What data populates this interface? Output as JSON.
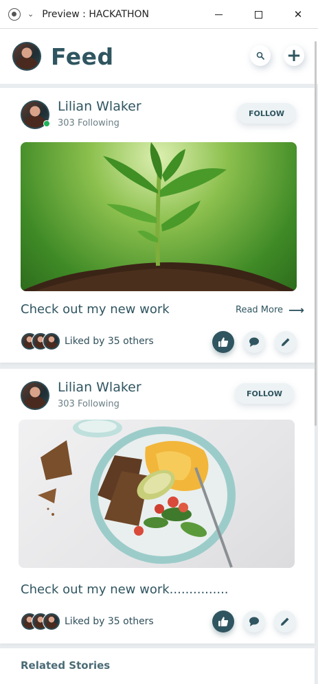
{
  "window": {
    "title": "Preview : HACKATHON",
    "chevron_icon": "chevron-down-icon"
  },
  "header": {
    "title": "Feed",
    "search_icon": "search-icon",
    "add_label": "+"
  },
  "posts": [
    {
      "author": "Lilian Wlaker",
      "subtitle": "303 Following",
      "follow_label": "FOLLOW",
      "online": true,
      "image": "plant-sprout-photo",
      "caption": "Check out my new work",
      "read_more": "Read More",
      "liked_text": "Liked by 35 others",
      "liked": true
    },
    {
      "author": "Lilian Wlaker",
      "subtitle": "303 Following",
      "follow_label": "FOLLOW",
      "online": false,
      "image": "food-plate-photo",
      "caption": "Check out my new work...............",
      "liked_text": "Liked by 35 others",
      "liked": true
    }
  ],
  "related": {
    "title": "Related Stories"
  },
  "colors": {
    "primary": "#2f5560",
    "online": "#1fb25a",
    "button_bg": "#edf2f4"
  }
}
